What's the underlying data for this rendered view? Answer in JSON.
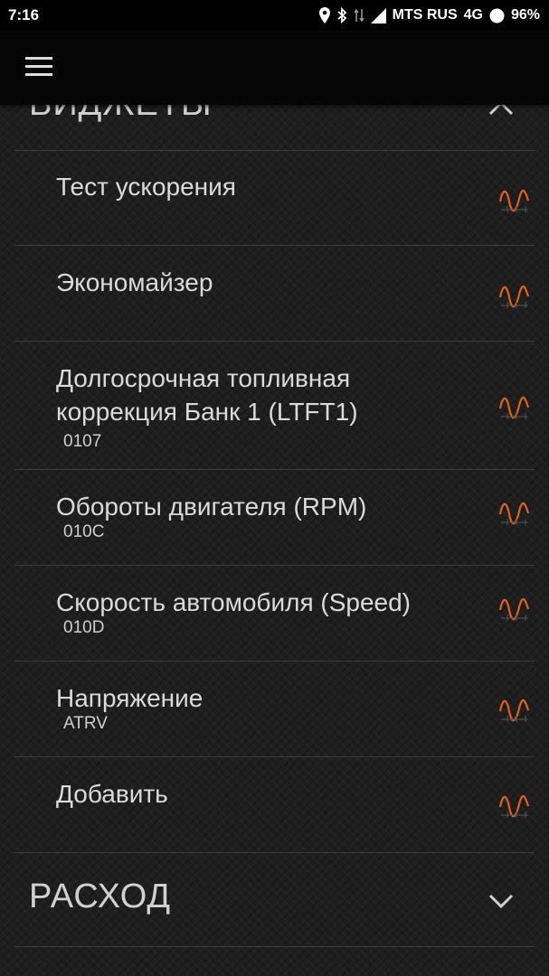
{
  "status_bar": {
    "time": "7:16",
    "carrier": "MTS RUS",
    "network": "4G",
    "battery": "96%",
    "icons": [
      "location-icon",
      "bluetooth-icon",
      "data-transfer-icon",
      "signal-icon",
      "battery-icon"
    ]
  },
  "app_bar": {
    "menu_icon": "hamburger-menu-icon"
  },
  "sections": {
    "widgets": {
      "title": "ВИДЖЕТЫ",
      "expanded": true,
      "icon": "chevron-up-icon"
    },
    "consumption": {
      "title": "РАСХОД",
      "expanded": false,
      "icon": "chevron-down-icon"
    }
  },
  "widget_items": [
    {
      "title": "Тест ускорения",
      "code": "",
      "icon": "chart-icon"
    },
    {
      "title": "Экономайзер",
      "code": "",
      "icon": "chart-icon"
    },
    {
      "title": "Долгосрочная топливная коррекция Банк 1 (LTFT1)",
      "code": "0107",
      "icon": "chart-icon"
    },
    {
      "title": "Обороты двигателя (RPM)",
      "code": "010C",
      "icon": "chart-icon"
    },
    {
      "title": "Скорость автомобиля (Speed)",
      "code": "010D",
      "icon": "chart-icon"
    },
    {
      "title": "Напряжение",
      "code": "ATRV",
      "icon": "chart-icon"
    },
    {
      "title": "Добавить",
      "code": "",
      "icon": "chart-icon"
    }
  ],
  "colors": {
    "accent": "#e0621c",
    "background": "#1e1e1e",
    "app_bar": "#050505",
    "status_bar": "#000000",
    "text": "#dadada",
    "divider": "#3c3c3c"
  }
}
